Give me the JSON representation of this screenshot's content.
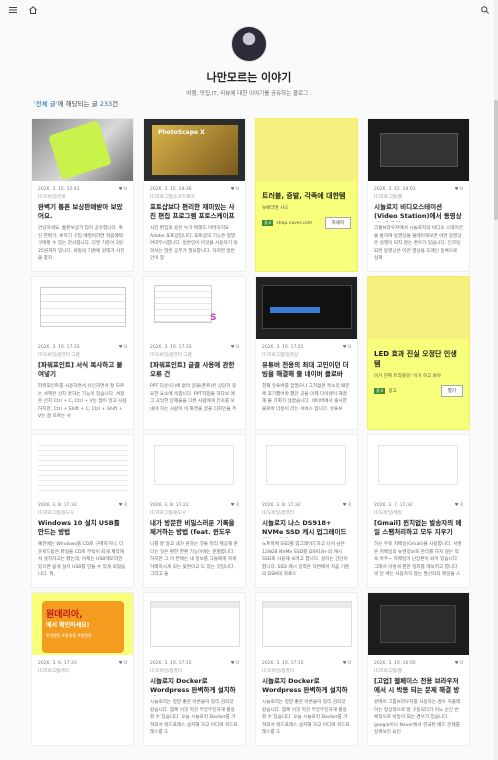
{
  "topbar": {
    "menu_icon": "hamburger-menu-icon",
    "home_icon": "home-icon",
    "search_icon": "search-icon"
  },
  "blog": {
    "title": "나만모르는 이야기",
    "description": "여행, 맛집,IT, 리뷰에 대한 이야기를 공유하는 블로그 ."
  },
  "category_line": {
    "category": "'전체 글'",
    "middle": "에 해당되는 글 ",
    "count": "233",
    "suffix": "건"
  },
  "cards": [
    {
      "type": "post",
      "thumb": "phone-thumb",
      "date": "2026. 3. 15. 12:42",
      "likes": "0",
      "category": "IT/모바일/전화",
      "title": "완벽기 통폰 보상판매받아 보았어요.",
      "excerpt": "안녕하세요. 통폰보상기 업어 공유합니다. 폭신 한편기, 루저기 구입 예정이라면 적립혜택 구매할 수 있는 잔사업니다. 다면 기준이 3일 25원까지 입니다. 바탕의 기준에 원래가 사진을 찾지"
    },
    {
      "type": "post",
      "thumb": "photoshop-thumb",
      "date": "2026. 3. 15. 19:36",
      "likes": "0",
      "category": "IT/프로그램/소프트웨어",
      "title": "포토샵보다 편리한 재미있는 사진 편집 프로그램 포토스케이프",
      "excerpt": "사진 편집의 용은 누가 뭐래도 아마하지요 Adobe 포토샵입니다. 포토샵의 기능은 정말 어마무시합니다. 일반인이 이것을 사용하기 막혀서는 많은 공부가 필요합니다. 하지만 일반인이 찾"
    },
    {
      "type": "ad",
      "title": "트러블, 증발, 각족에 대한템",
      "sub": "뉴베라앤 사오",
      "source": "shop.naver.com",
      "tag": "광고",
      "button": "자세히"
    },
    {
      "type": "post",
      "thumb": "dark-screen-thumb",
      "date": "2026. 3. 12. 19:03",
      "likes": "0",
      "category": "IT/프로그램/웹",
      "title": "시놀로지 비디오스테이션(Video Station)에서 동영상이 재생되…",
      "excerpt": "크롬브라우저에서 시놀로지의 비디오 스테이션을 통하여 동영상을 플레이해보면 어떤 동영상은 실행이 되지 않는 경우가 있습니다. 인코딩 되면 동영상은 어떤 영상을 도메인 등록으로 살펴"
    },
    {
      "type": "post",
      "thumb": "table-thumb",
      "date": "2026. 3. 10. 17:33",
      "likes": "0",
      "category": "IT/모바일/컴퓨터 그램",
      "title": "[파워포인트] 서식 복사하고 붙여넣기",
      "excerpt": "파워포인트를 사용하면서 유인하면서 잘 모르는 서핵은 선지 못하는 기능이 있습니다. 서봉은 선지 Ctrl + C, Ctrl + V는 많이 알고 사용하지만, Ctrl + Shift + C, Ctrl + Shift + V는 잘 모르는 사"
    },
    {
      "type": "post",
      "thumb": "settings-thumb",
      "date": "2026. 3. 10. 17:33",
      "likes": "0",
      "category": "IT/모바일/컴퓨터 그램",
      "title": "[파워포인트] 글꼴 사용에 관한 오류 건",
      "excerpt": "PPT 다운(으)에 없어 글꼴(폰트)은 상당히 중요한 요소에 속합니다. PPT작업을 하다보 에 그 곡일한 문제들을 다른 사람에게 전초를 보내야 하는 사람이 이 화면을 글꼴 디자인을 주"
    },
    {
      "type": "post",
      "thumb": "editor-thumb",
      "date": "2026. 3. 10. 17:22",
      "likes": "0",
      "category": "IT/프로그램/동영상",
      "title": "유튜버 전용의 최대 고민이던 더빙을 해결해 줄 네이버 클로바 …",
      "excerpt": "현재 유튜버를 꿈꿨으나 그치없은 목소리 때문에 포기했어야 했던 공을 이제 다이렌이 해결해 줄 기회가 생겼습니다. 네이버에서 출시한 클로바 더빙이 라는 서비스 입니다. 유튜브"
    },
    {
      "type": "ad",
      "title": "LED 효과 진실 오정단 인생템",
      "sub": "이거 진짜 트리플뷰! 이거 하고 봐야",
      "source": "광고",
      "tag": "광고",
      "button": "열기"
    },
    {
      "type": "post",
      "thumb": "document-thumb",
      "date": "2026. 3. 8. 17:32",
      "likes": "0",
      "category": "IT/프로그램/윈도우",
      "title": "Windows 10 설치 USB를 만드는 방법",
      "excerpt": "예전에는 Windows를 CD로 구매하거나, 다운로드받은 파일을 CD로 부탁이 되게 제작해서 설치하고는 했는데, 이제는 USB메모리만 있으면 쉽게 설치 USB를 만들 수 있게 되었습니다. 뭐,"
    },
    {
      "type": "post",
      "thumb": "blank-thumb",
      "date": "2026. 3. 8. 17:22",
      "likes": "0",
      "category": "IT/프로그램/윈도우",
      "title": "내가 방문한 비밀스러운 기록을 제거하는 방법 (feat. 윈도우10)",
      "excerpt": "나를 잘 알고 내가 원하는 것을 미리 제공해 준다는 것은 편한 한편 기능이에는 분명합니다. 하지만 그 이 면에는 내 정보를 그들에게 하게 거래하시게 되는 뒷면이고 도 있는 것입니다. 그리고 들"
    },
    {
      "type": "post",
      "thumb": "blank-thumb-2",
      "date": "2026. 3. 8. 17:32",
      "likes": "0",
      "category": "IT/모바일/컴퓨터",
      "title": "시놀로지 나스 DS918+ NVMe SSD 캐시 업그레이드하는 방법",
      "excerpt": "노트북에 SSD를 업그레이드하고 나서 남은 128GB NVMe SSD를 DS918+의 캐시 SSD로 사용해 보려고 합니다. 설치는 간단이 합니다. SSD 캐시 장착은 하면에서 처음 기준의 DSM의 자료스"
    },
    {
      "type": "post",
      "thumb": "blank-thumb-3",
      "date": "2026. 3. 7. 17:32",
      "likes": "0",
      "category": "IT/모바일/메일",
      "title": "[Gmail] 윈치없는 발송자의 메일 스팸처리하고 모두 지우기",
      "excerpt": "하는 주로 지메일(Gmail)을 사용합니다. 서명은 지메일의 뉴엔징보로 관리를 하지 않는 익숙 아주~ 지메일이 난장판이 되어 있습니다. 그래서 이렇게 판만 정리를 해보려고 합니다. 빗 단 메는 사용하지 않는 발신자의 메일을 스팸처리하고 지금까지 온 모든 이메일을 삭제하는 것입니다. 윈치않는 이메일이 제 온 메일을 스팸처리하여 그 다음 Gmail에 오고있던 메일 것입니다. 그리고 나머지 순서는 아래와 같습니다. 찾"
    },
    {
      "type": "post",
      "thumb": "promo-thumb",
      "date": "2026. 3. 6. 17:33",
      "likes": "0",
      "category": "IT/프로그램/워드",
      "title": "",
      "excerpt": "",
      "promo_big": "원데리아,",
      "promo_sub": "에서 확인하세요!",
      "promo_small": "#쌍렌캉 #쾅쾅쾅 #쾅렌캉"
    },
    {
      "type": "post",
      "thumb": "browser-thumb",
      "date": "2026. 3. 10. 17:15",
      "likes": "0",
      "category": "IT/모바일/컴퓨터",
      "title": "시놀로지 Docker로 Wordpress 완벽하게 설치하기",
      "excerpt": "시놀로지는 정말 좋은 이론들이 정리 검의것 같습니다. 함께 이것 저것 무궁무진하게 활용할 수 있습니다. 오늘 시놀로지 Docker를 가져와서 워드프레스 설치해 하고 이디에 워드프레스를 도"
    },
    {
      "type": "post",
      "thumb": "browser-thumb-2",
      "date": "2026. 3. 10. 17:15",
      "likes": "0",
      "category": "IT/모바일/컴퓨터",
      "title": "시놀로지 Docker로 Wordpress 완벽하게 설치하기",
      "excerpt": "시놀로지는 정말 좋은 이론들이 정리 검의것 같습니다. 함께 이것 저것 무궁무진하게 활용할 수 있습니다. 오늘 시놀로지 Docker를 가져와서 워드프레스 설치해 하고 이디에 워드프레스를 도"
    },
    {
      "type": "post",
      "thumb": "screen-thumb",
      "date": "2026. 3. 10. 16:00",
      "likes": "0",
      "category": "IT/프로그램/웹",
      "title": "[고업] 웹페이스 전용 브라우저에서 시 박동 되는 문제 해결 방법",
      "excerpt": "윈메이 그룹브라우저를 사용하는 경우 지플레이는 정상적으로 잘 구동되다가 어느 순간 반복적으로 박동이 되는 경우가 있습니다. google이나 Naver에서 한국된 배드 문제를 살펴보던 요인"
    }
  ]
}
